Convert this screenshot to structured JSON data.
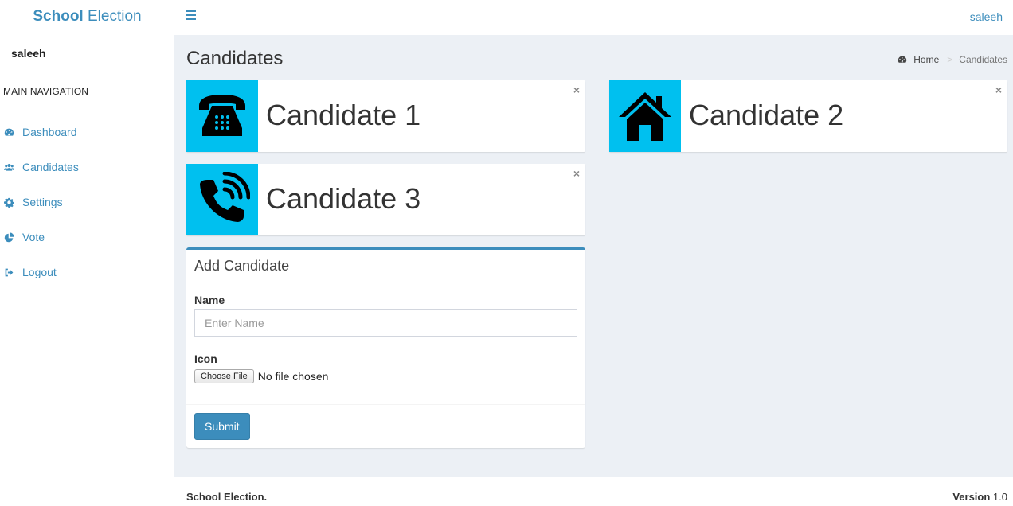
{
  "brand": {
    "bold": "School",
    "light": "Election"
  },
  "sidebar": {
    "user": "saleeh",
    "header": "MAIN NAVIGATION",
    "items": [
      {
        "label": "Dashboard",
        "icon": "dashboard-icon"
      },
      {
        "label": "Candidates",
        "icon": "users-icon"
      },
      {
        "label": "Settings",
        "icon": "gear-icon"
      },
      {
        "label": "Vote",
        "icon": "pie-chart-icon"
      },
      {
        "label": "Logout",
        "icon": "sign-out-icon"
      }
    ]
  },
  "topbar": {
    "user": "saleeh"
  },
  "page": {
    "title": "Candidates",
    "breadcrumb": {
      "home": "Home",
      "separator": ">",
      "current": "Candidates"
    }
  },
  "candidates": [
    {
      "name": "Candidate 1",
      "icon": "telephone-icon",
      "close": "×"
    },
    {
      "name": "Candidate 2",
      "icon": "home-icon",
      "close": "×"
    },
    {
      "name": "Candidate 3",
      "icon": "phone-call-icon",
      "close": "×"
    }
  ],
  "form": {
    "title": "Add Candidate",
    "name_label": "Name",
    "name_placeholder": "Enter Name",
    "icon_label": "Icon",
    "file_button": "Choose File",
    "file_status": "No file chosen",
    "submit": "Submit"
  },
  "footer": {
    "left": "School Election.",
    "version_label": "Version",
    "version": "1.0"
  },
  "colors": {
    "primary": "#3c8dbc",
    "icon_bg": "#00c0ef",
    "content_bg": "#ecf0f5"
  }
}
